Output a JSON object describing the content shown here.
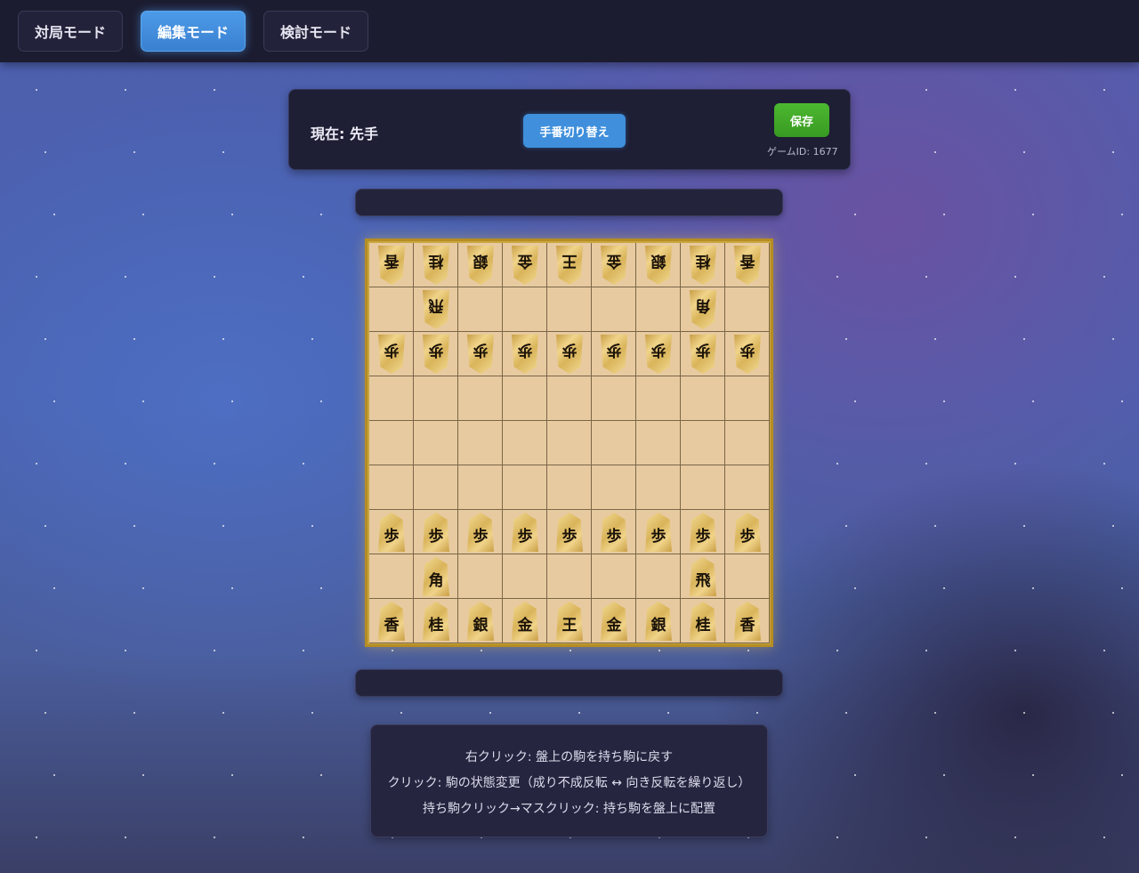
{
  "modes": [
    {
      "label": "対局モード",
      "active": false
    },
    {
      "label": "編集モード",
      "active": true
    },
    {
      "label": "検討モード",
      "active": false
    }
  ],
  "status": {
    "turn": "現在: 先手",
    "switch_label": "手番切り替え",
    "save_label": "保存",
    "game_id": "ゲームID: 1677"
  },
  "board": {
    "rows": [
      [
        {
          "p": "香",
          "o": "gote"
        },
        {
          "p": "桂",
          "o": "gote"
        },
        {
          "p": "銀",
          "o": "gote"
        },
        {
          "p": "金",
          "o": "gote"
        },
        {
          "p": "王",
          "o": "gote"
        },
        {
          "p": "金",
          "o": "gote"
        },
        {
          "p": "銀",
          "o": "gote"
        },
        {
          "p": "桂",
          "o": "gote"
        },
        {
          "p": "香",
          "o": "gote"
        }
      ],
      [
        null,
        {
          "p": "飛",
          "o": "gote"
        },
        null,
        null,
        null,
        null,
        null,
        {
          "p": "角",
          "o": "gote"
        },
        null
      ],
      [
        {
          "p": "歩",
          "o": "gote"
        },
        {
          "p": "歩",
          "o": "gote"
        },
        {
          "p": "歩",
          "o": "gote"
        },
        {
          "p": "歩",
          "o": "gote"
        },
        {
          "p": "歩",
          "o": "gote"
        },
        {
          "p": "歩",
          "o": "gote"
        },
        {
          "p": "歩",
          "o": "gote"
        },
        {
          "p": "歩",
          "o": "gote"
        },
        {
          "p": "歩",
          "o": "gote"
        }
      ],
      [
        null,
        null,
        null,
        null,
        null,
        null,
        null,
        null,
        null
      ],
      [
        null,
        null,
        null,
        null,
        null,
        null,
        null,
        null,
        null
      ],
      [
        null,
        null,
        null,
        null,
        null,
        null,
        null,
        null,
        null
      ],
      [
        {
          "p": "歩",
          "o": "sente"
        },
        {
          "p": "歩",
          "o": "sente"
        },
        {
          "p": "歩",
          "o": "sente"
        },
        {
          "p": "歩",
          "o": "sente"
        },
        {
          "p": "歩",
          "o": "sente"
        },
        {
          "p": "歩",
          "o": "sente"
        },
        {
          "p": "歩",
          "o": "sente"
        },
        {
          "p": "歩",
          "o": "sente"
        },
        {
          "p": "歩",
          "o": "sente"
        }
      ],
      [
        null,
        {
          "p": "角",
          "o": "sente"
        },
        null,
        null,
        null,
        null,
        null,
        {
          "p": "飛",
          "o": "sente"
        },
        null
      ],
      [
        {
          "p": "香",
          "o": "sente"
        },
        {
          "p": "桂",
          "o": "sente"
        },
        {
          "p": "銀",
          "o": "sente"
        },
        {
          "p": "金",
          "o": "sente"
        },
        {
          "p": "王",
          "o": "sente"
        },
        {
          "p": "金",
          "o": "sente"
        },
        {
          "p": "銀",
          "o": "sente"
        },
        {
          "p": "桂",
          "o": "sente"
        },
        {
          "p": "香",
          "o": "sente"
        }
      ]
    ]
  },
  "help": [
    "右クリック: 盤上の駒を持ち駒に戻す",
    "クリック: 駒の状態変更（成り不成反転 ↔ 向き反転を繰り返し）",
    "持ち駒クリック→マスクリック: 持ち駒を盤上に配置"
  ],
  "colors": {
    "accent": "#3f8fdc",
    "save": "#44b02a",
    "board": "#e8caa0"
  }
}
